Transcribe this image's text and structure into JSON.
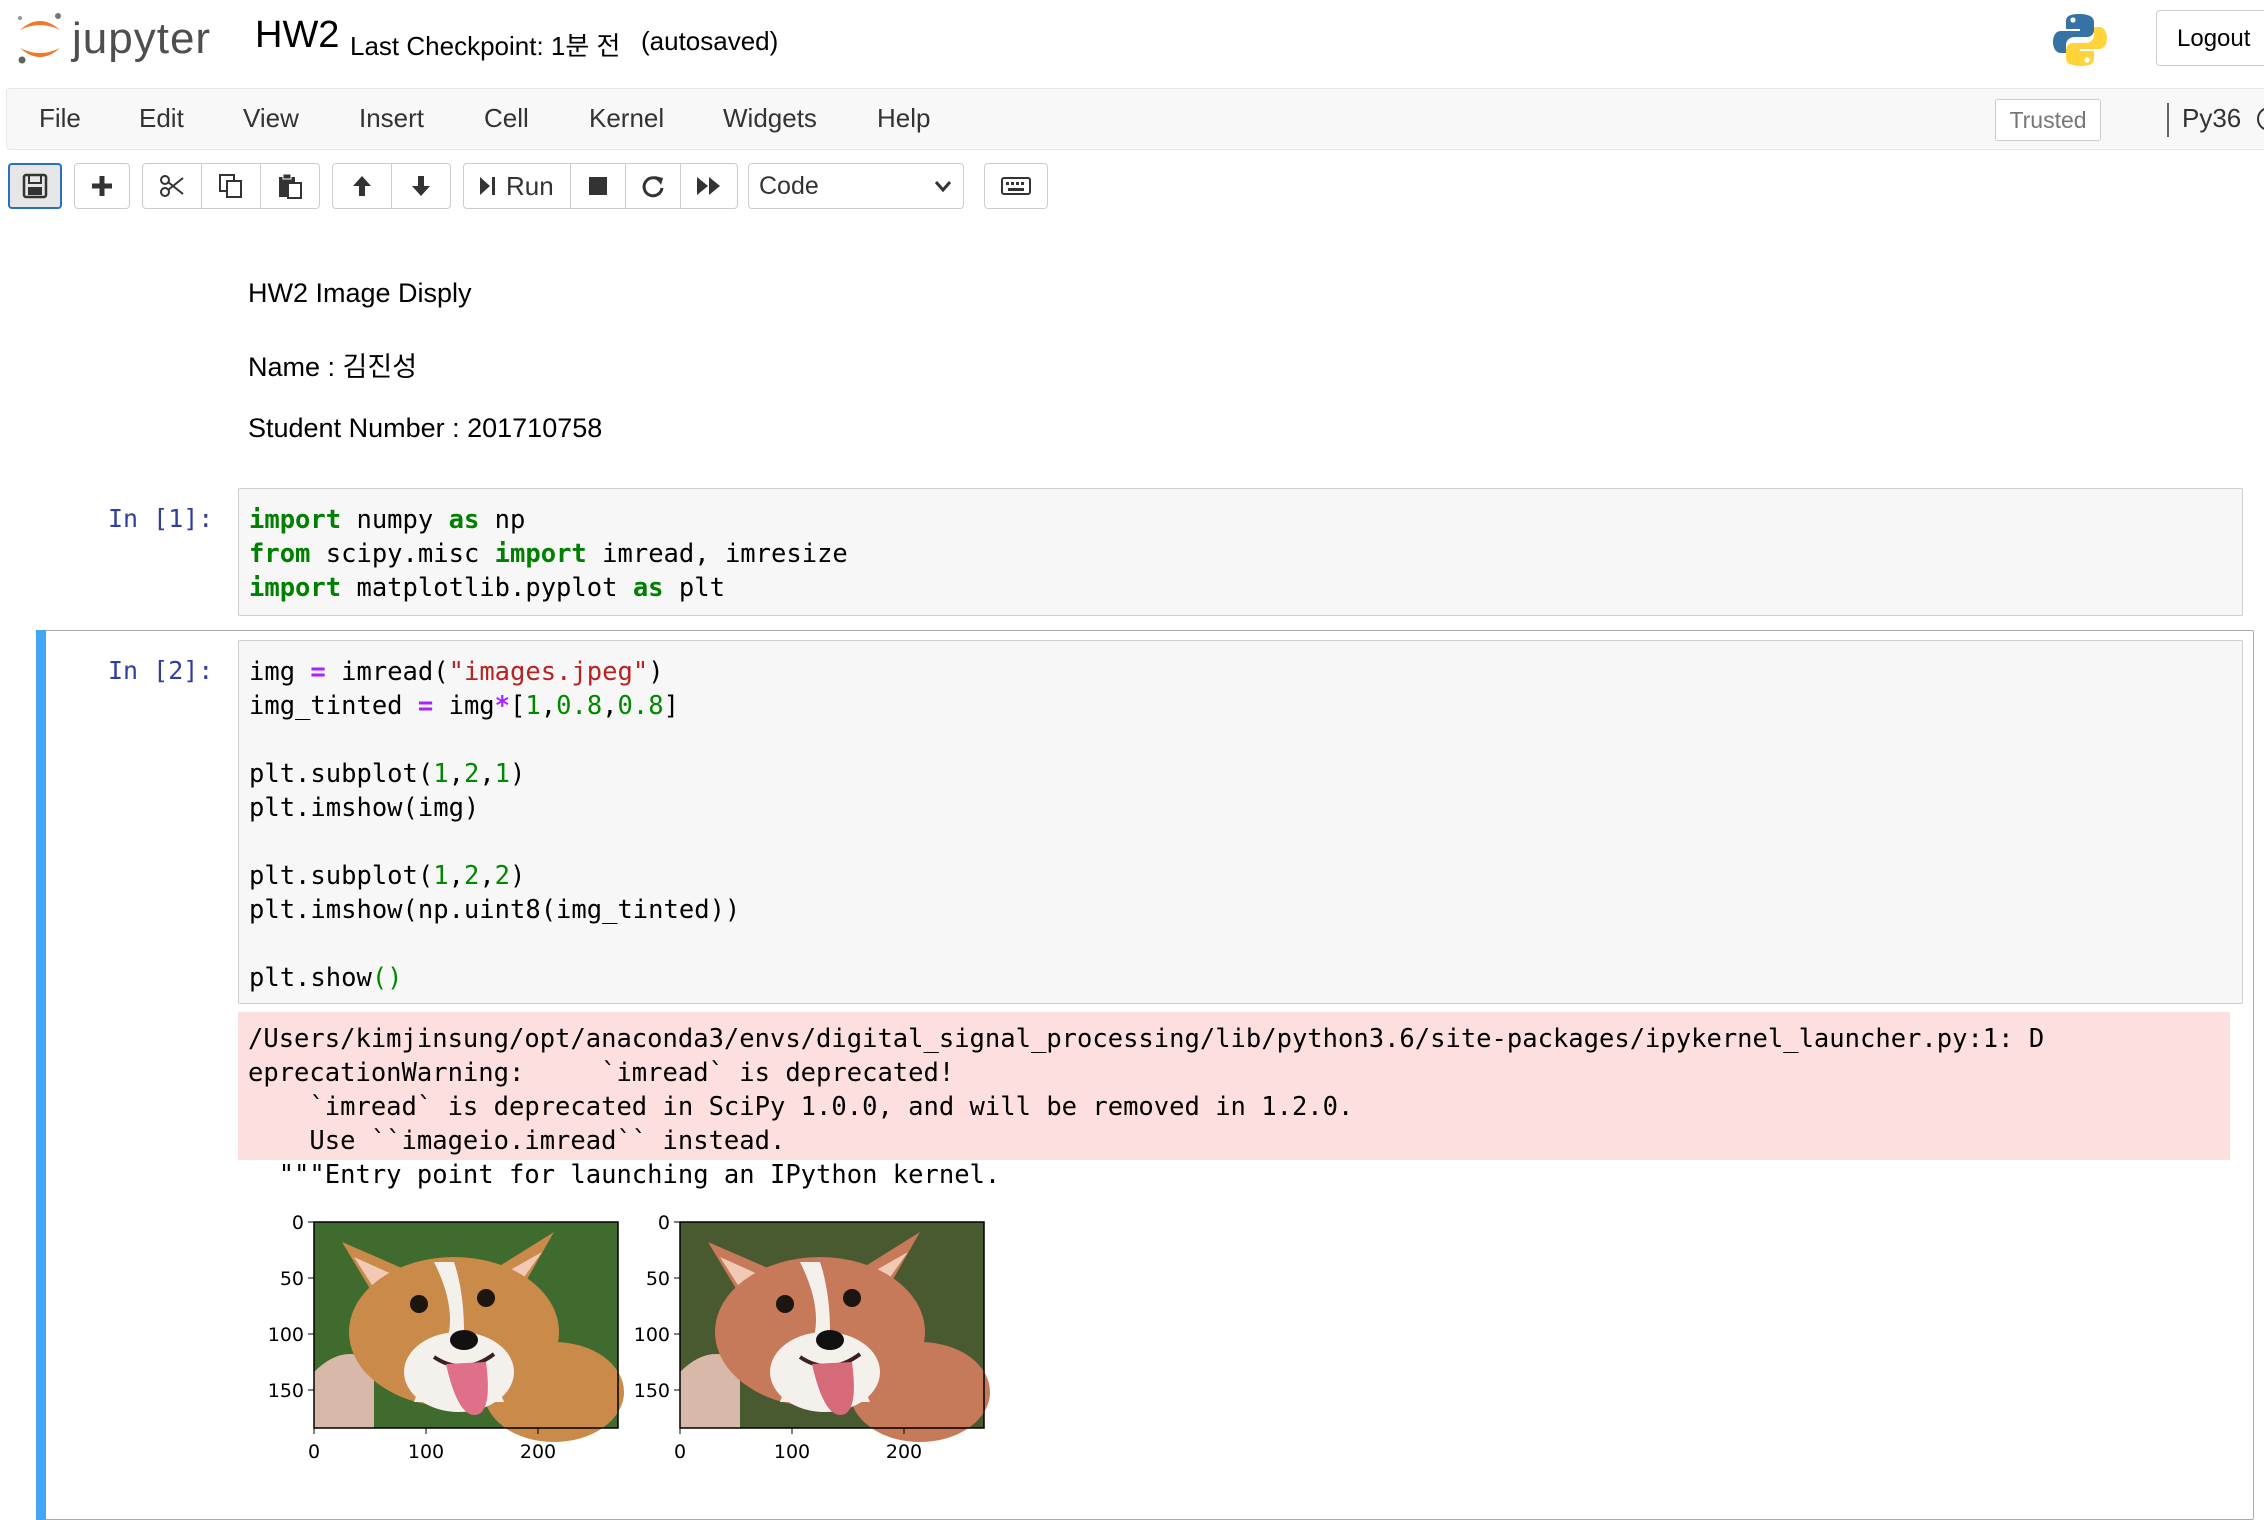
{
  "header": {
    "logo_text": "jupyter",
    "notebook_name": "HW2",
    "checkpoint": "Last Checkpoint: 1분 전",
    "autosaved": "(autosaved)",
    "logout_label": "Logout"
  },
  "menubar": {
    "items": [
      "File",
      "Edit",
      "View",
      "Insert",
      "Cell",
      "Kernel",
      "Widgets",
      "Help"
    ],
    "trusted": "Trusted",
    "kernel": "Py36"
  },
  "toolbar": {
    "run_label": "Run",
    "cell_type": "Code",
    "icons": [
      "save-icon",
      "plus-icon",
      "cut-icon",
      "copy-icon",
      "paste-icon",
      "arrow-up-icon",
      "arrow-down-icon",
      "run-icon",
      "stop-icon",
      "restart-icon",
      "fast-forward-icon",
      "keyboard-icon"
    ]
  },
  "markdown": {
    "title": "HW2 Image Disply",
    "name": "Name : 김진성",
    "student_number": "Student Number : 201710758"
  },
  "cells": [
    {
      "prompt": "In [1]:",
      "lines": [
        "import numpy as np",
        "from scipy.misc import imread, imresize",
        "import matplotlib.pyplot as plt"
      ]
    },
    {
      "prompt": "In [2]:",
      "lines": [
        "img = imread(\"images.jpeg\")",
        "img_tinted = img*[1,0.8,0.8]",
        "",
        "plt.subplot(1,2,1)",
        "plt.imshow(img)",
        "",
        "plt.subplot(1,2,2)",
        "plt.imshow(np.uint8(img_tinted))",
        "",
        "plt.show()"
      ],
      "stderr": [
        "/Users/kimjinsung/opt/anaconda3/envs/digital_signal_processing/lib/python3.6/site-packages/ipykernel_launcher.py:1: D",
        "eprecationWarning:     `imread` is deprecated!",
        "    `imread` is deprecated in SciPy 1.0.0, and will be removed in 1.2.0.",
        "    Use ``imageio.imread`` instead.",
        "  \"\"\"Entry point for launching an IPython kernel."
      ]
    }
  ],
  "plot": {
    "y_ticks": [
      "0",
      "50",
      "100",
      "150"
    ],
    "x_ticks": [
      "0",
      "100",
      "200"
    ],
    "panels": [
      "original",
      "tinted"
    ],
    "colors": {
      "grass": "#3f6b2e",
      "fur_orange": "#c98a4a",
      "fur_white": "#f4f1ec",
      "tongue": "#e0708a",
      "tinted_grass": "#4a5a30",
      "tinted_fur_orange": "#c67a5a"
    }
  },
  "colors": {
    "accent": "#42a5f5",
    "prompt": "#303f9f",
    "keyword": "#008000",
    "operator": "#aa22ff",
    "string": "#ba2121",
    "stderr_bg": "#fddfdf"
  }
}
